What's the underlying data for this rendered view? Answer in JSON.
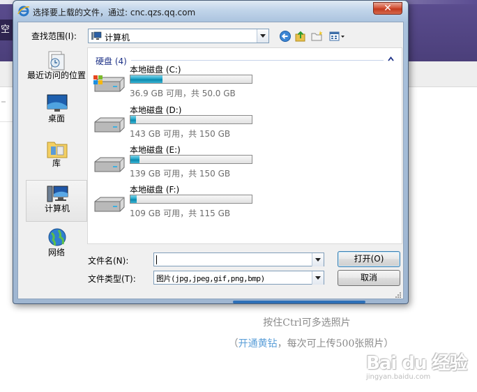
{
  "background": {
    "left_char": "空",
    "hint_multi_select": "按住Ctrl可多选照片",
    "hint_vip_link": "开通黄钻",
    "hint_vip_suffix": "，每次可上传500张照片）",
    "hint_vip_open": "（",
    "watermark_logo": "Bai du 经验",
    "watermark_url": "jingyan.baidu.com"
  },
  "dialog": {
    "title": "选择要上载的文件，通过: cnc.qzs.qq.com",
    "close_glyph": "✕",
    "look_in_label": "查找范围(I):",
    "look_in_value": "计算机",
    "places": [
      {
        "label": "最近访问的位置"
      },
      {
        "label": "桌面"
      },
      {
        "label": "库"
      },
      {
        "label": "计算机"
      },
      {
        "label": "网络"
      }
    ],
    "group_header": "硬盘 (4)",
    "drives": [
      {
        "name": "本地磁盘 (C:)",
        "info": "36.9 GB 可用，共 50.0 GB",
        "used_fraction": 0.262
      },
      {
        "name": "本地磁盘 (D:)",
        "info": "143 GB 可用，共 150 GB",
        "used_fraction": 0.047
      },
      {
        "name": "本地磁盘 (E:)",
        "info": "139 GB 可用，共 150 GB",
        "used_fraction": 0.073
      },
      {
        "name": "本地磁盘 (F:)",
        "info": "109 GB 可用，共 115 GB",
        "used_fraction": 0.052
      }
    ],
    "filename_label": "文件名(N):",
    "filename_value": "",
    "filetype_label": "文件类型(T):",
    "filetype_value": "图片(jpg,jpeg,gif,png,bmp)",
    "open_button": "打开(O)",
    "cancel_button": "取消"
  },
  "icons": {
    "back": "back-arrow-icon",
    "up": "up-folder-icon",
    "new_folder": "new-folder-icon",
    "views": "views-menu-icon"
  },
  "colors": {
    "accent_blue": "#1e3287",
    "drive_bar": "#23a7c9",
    "page_purple": "#4b3f7a",
    "vip_link": "#5a9ed8"
  }
}
